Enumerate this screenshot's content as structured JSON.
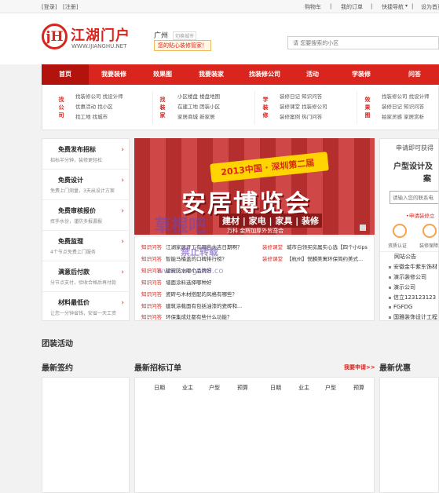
{
  "topbar": {
    "login": "[登录]",
    "register": "[注册]",
    "cart": "购物车",
    "sep": "|",
    "orders": "我的订单",
    "quicknav": "快捷导航",
    "fav": "设为首页"
  },
  "header": {
    "logo_mark": "jH",
    "logo_cn": "江湖门户",
    "logo_en": "WWW.IJIANGHU.NET",
    "city": "广州",
    "switch_city": "切换城市",
    "slogan": "您的贴心装修管家！",
    "search_placeholder": "请 您要搜索的小区"
  },
  "nav": [
    "首页",
    "我要装修",
    "效果图",
    "我要装家",
    "找装修公司",
    "活动",
    "学装修",
    "问答"
  ],
  "subnav": {
    "groups": [
      {
        "title": "找公司",
        "rows": [
          "找装修公司 找设计师",
          "优惠活动 找小区",
          "找工地 找城市"
        ]
      },
      {
        "title": "找装家",
        "rows": [
          "小区楼盘 楼盘地图",
          "在建工地 团装小区",
          "家居商城 新家居"
        ]
      },
      {
        "title": "学装修",
        "rows": [
          "装修日记 知识问答",
          "装修课堂 找装修公司",
          "装修案例 热门问答"
        ]
      },
      {
        "title": "效果图",
        "rows": [
          "找装修公司 找设计师",
          "装修日记 知识问答",
          "拍家灵感 家居赏析"
        ]
      }
    ]
  },
  "left_services": [
    {
      "title": "免费发布招标",
      "sub": "招标半分钟，装修更轻松"
    },
    {
      "title": "免费设计",
      "sub": "免费上门测量，3天出设计方案"
    },
    {
      "title": "免费审核报价",
      "sub": "挥手水份，谨防多报漏报"
    },
    {
      "title": "免费监理",
      "sub": "4个节点免费上门服务"
    },
    {
      "title": "满意后付款",
      "sub": "分节点支付，验收合格后再付款"
    },
    {
      "title": "材料最低价",
      "sub": "让您一分钟省钱，安省一天工资"
    }
  ],
  "banner": {
    "year_line": "2013中国 · 深圳第二届",
    "main_title": "安居博览会",
    "categories": "建材 | 家电 | 家具 | 装修",
    "fair": "万科   金辉加厚外贸吾合"
  },
  "qa": [
    {
      "tag": "知识问答",
      "text": "江湖家居开工有哪些大吉日期啊？"
    },
    {
      "tag": "知识问答",
      "text": "智能马桶盖的口碑排行榜？"
    },
    {
      "tag": "知识问答",
      "text": "建筑防水哪个品牌好"
    },
    {
      "tag": "知识问答",
      "text": "墙面涂料选择哪种好"
    },
    {
      "tag": "知识问答",
      "text": "瓷砖与木材搭配的风格有哪些？"
    },
    {
      "tag": "知识问答",
      "text": "建筑涂载面有包括油漆的瓷砖和..."
    },
    {
      "tag": "知识问答",
      "text": "环保集成灶都有些什么功能？"
    }
  ],
  "qa_right": [
    {
      "tag": "装修课堂",
      "text": "城市白领买房属实心选【四个小tips"
    },
    {
      "tag": "装修课堂",
      "text": "【杭州】悦麟美寓环保简约美式..."
    }
  ],
  "right_panel": {
    "t1": "申请即可获得",
    "t2": "户型设计及",
    "t3": "案",
    "input_placeholder": "请输入您的联系电",
    "hint": "•申请装修立",
    "cap1": "资质认证",
    "cap2": "装修保障",
    "notice": "网站公告",
    "notices": [
      "安徽金牛紫东饰材",
      "演示装修公司",
      "演示公司",
      "信立123123123",
      "FGFDG",
      "国雅装饰设计工程"
    ]
  },
  "sections": {
    "group": "团装活动",
    "latest_sign": "最新签约",
    "latest_bids": "最新招标订单",
    "post_bid": "我要申请>>",
    "latest_offer": "最新优惠"
  },
  "bid_headers": [
    "日期",
    "业主",
    "户型",
    "预算",
    "日期",
    "业主",
    "户型",
    "预算"
  ],
  "watermark": {
    "line1": "草根吧",
    "line2": "禁止转载",
    "line3": "www.caogen8.co"
  },
  "colors": {
    "brand": "#d9251d",
    "nav_active": "#b3130d"
  }
}
